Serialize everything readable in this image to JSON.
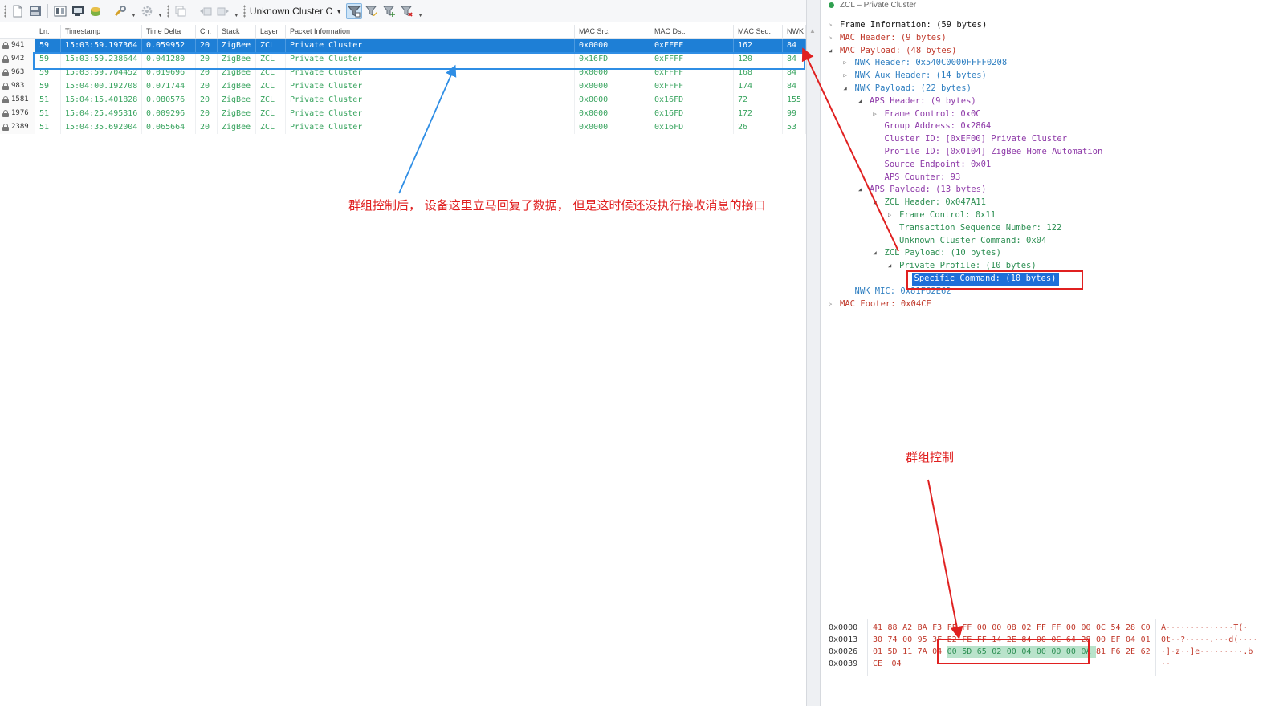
{
  "toolbar": {
    "filter_label": "Unknown Cluster C"
  },
  "packet_list": {
    "columns": [
      {
        "key": "num",
        "label": ""
      },
      {
        "key": "ln",
        "label": "Ln."
      },
      {
        "key": "ts",
        "label": "Timestamp"
      },
      {
        "key": "delta",
        "label": "Time Delta"
      },
      {
        "key": "ch",
        "label": "Ch."
      },
      {
        "key": "stack",
        "label": "Stack"
      },
      {
        "key": "layer",
        "label": "Layer"
      },
      {
        "key": "info",
        "label": "Packet Information"
      },
      {
        "key": "src",
        "label": "MAC Src."
      },
      {
        "key": "dst",
        "label": "MAC Dst."
      },
      {
        "key": "seq",
        "label": "MAC Seq."
      },
      {
        "key": "nwk",
        "label": "NWK"
      }
    ],
    "rows": [
      {
        "num": "941",
        "ln": "59",
        "ts": "15:03:59.197364",
        "delta": "0.059952",
        "ch": "20",
        "stack": "ZigBee",
        "layer": "ZCL",
        "info": "Private Cluster",
        "src": "0x0000",
        "dst": "0xFFFF",
        "seq": "162",
        "nwk": "84",
        "selected": true
      },
      {
        "num": "942",
        "ln": "59",
        "ts": "15:03:59.238644",
        "delta": "0.041280",
        "ch": "20",
        "stack": "ZigBee",
        "layer": "ZCL",
        "info": "Private Cluster",
        "src": "0x16FD",
        "dst": "0xFFFF",
        "seq": "120",
        "nwk": "84",
        "selected": false
      },
      {
        "num": "963",
        "ln": "59",
        "ts": "15:03:59.704452",
        "delta": "0.019696",
        "ch": "20",
        "stack": "ZigBee",
        "layer": "ZCL",
        "info": "Private Cluster",
        "src": "0x0000",
        "dst": "0xFFFF",
        "seq": "168",
        "nwk": "84",
        "selected": false
      },
      {
        "num": "983",
        "ln": "59",
        "ts": "15:04:00.192708",
        "delta": "0.071744",
        "ch": "20",
        "stack": "ZigBee",
        "layer": "ZCL",
        "info": "Private Cluster",
        "src": "0x0000",
        "dst": "0xFFFF",
        "seq": "174",
        "nwk": "84",
        "selected": false
      },
      {
        "num": "1581",
        "ln": "51",
        "ts": "15:04:15.401828",
        "delta": "0.080576",
        "ch": "20",
        "stack": "ZigBee",
        "layer": "ZCL",
        "info": "Private Cluster",
        "src": "0x0000",
        "dst": "0x16FD",
        "seq": "72",
        "nwk": "155",
        "selected": false
      },
      {
        "num": "1976",
        "ln": "51",
        "ts": "15:04:25.495316",
        "delta": "0.009296",
        "ch": "20",
        "stack": "ZigBee",
        "layer": "ZCL",
        "info": "Private Cluster",
        "src": "0x0000",
        "dst": "0x16FD",
        "seq": "172",
        "nwk": "99",
        "selected": false
      },
      {
        "num": "2389",
        "ln": "51",
        "ts": "15:04:35.692004",
        "delta": "0.065664",
        "ch": "20",
        "stack": "ZigBee",
        "layer": "ZCL",
        "info": "Private Cluster",
        "src": "0x0000",
        "dst": "0x16FD",
        "seq": "26",
        "nwk": "53",
        "selected": false
      }
    ]
  },
  "detail": {
    "title": "ZCL – Private Cluster",
    "nodes": [
      {
        "level": 0,
        "exp": "closed",
        "text": "Frame Information: (59 bytes)",
        "color": "#111111"
      },
      {
        "level": 0,
        "exp": "closed",
        "text": "MAC Header: (9 bytes)",
        "color": "#c0392b"
      },
      {
        "level": 0,
        "exp": "open",
        "text": "MAC Payload: (48 bytes)",
        "color": "#c0392b"
      },
      {
        "level": 1,
        "exp": "closed",
        "text": "NWK Header: 0x540C0000FFFF0208",
        "color": "#2f7fc1"
      },
      {
        "level": 1,
        "exp": "closed",
        "text": "NWK Aux Header: (14 bytes)",
        "color": "#2f7fc1"
      },
      {
        "level": 1,
        "exp": "open",
        "text": "NWK Payload: (22 bytes)",
        "color": "#2f7fc1"
      },
      {
        "level": 2,
        "exp": "open",
        "text": "APS Header: (9 bytes)",
        "color": "#8e3aa8"
      },
      {
        "level": 3,
        "exp": "closed",
        "text": "Frame Control: 0x0C",
        "color": "#8e3aa8"
      },
      {
        "level": 3,
        "exp": "none",
        "text": "Group Address: 0x2864",
        "color": "#8e3aa8"
      },
      {
        "level": 3,
        "exp": "none",
        "text": "Cluster ID: [0xEF00] Private Cluster",
        "color": "#8e3aa8"
      },
      {
        "level": 3,
        "exp": "none",
        "text": "Profile ID: [0x0104] ZigBee Home Automation",
        "color": "#8e3aa8"
      },
      {
        "level": 3,
        "exp": "none",
        "text": "Source Endpoint: 0x01",
        "color": "#8e3aa8"
      },
      {
        "level": 3,
        "exp": "none",
        "text": "APS Counter: 93",
        "color": "#8e3aa8"
      },
      {
        "level": 2,
        "exp": "open",
        "text": "APS Payload: (13 bytes)",
        "color": "#8e3aa8"
      },
      {
        "level": 3,
        "exp": "open",
        "text": "ZCL Header: 0x047A11",
        "color": "#2d8f53"
      },
      {
        "level": 4,
        "exp": "closed",
        "text": "Frame Control: 0x11",
        "color": "#2d8f53"
      },
      {
        "level": 4,
        "exp": "none",
        "text": "Transaction Sequence Number: 122",
        "color": "#2d8f53"
      },
      {
        "level": 4,
        "exp": "none",
        "text": "Unknown Cluster Command: 0x04",
        "color": "#2d8f53"
      },
      {
        "level": 3,
        "exp": "open",
        "text": "ZCL Payload: (10 bytes)",
        "color": "#2d8f53"
      },
      {
        "level": 4,
        "exp": "open",
        "text": "Private Profile: (10 bytes)",
        "color": "#2d8f53"
      },
      {
        "level": 5,
        "exp": "none",
        "text": "Specific Command: (10 bytes)",
        "color": "#ffffff",
        "selected": true
      },
      {
        "level": 1,
        "exp": "none",
        "text": "NWK MIC: 0x81F62E62",
        "color": "#2f7fc1"
      },
      {
        "level": 0,
        "exp": "closed",
        "text": "MAC Footer: 0x04CE",
        "color": "#c0392b"
      }
    ]
  },
  "hex": {
    "offsets": [
      "0x0000",
      "0x0013",
      "0x0026",
      "0x0039"
    ],
    "lines": [
      [
        "41",
        "88",
        "A2",
        "BA",
        "F3",
        "FF",
        "FF",
        "00",
        "00",
        "08",
        "02",
        "FF",
        "FF",
        "00",
        "00",
        "0C",
        "54",
        "28",
        "C0"
      ],
      [
        "30",
        "74",
        "00",
        "95",
        "3F",
        "E2",
        "FE",
        "FF",
        "14",
        "2E",
        "84",
        "00",
        "0C",
        "64",
        "28",
        "00",
        "EF",
        "04",
        "01"
      ],
      [
        "01",
        "5D",
        "11",
        "7A",
        "04",
        "00",
        "5D",
        "65",
        "02",
        "00",
        "04",
        "00",
        "00",
        "00",
        "0A",
        "81",
        "F6",
        "2E",
        "62"
      ],
      [
        "CE",
        "04"
      ]
    ],
    "highlight": {
      "line": 2,
      "start": 5,
      "end": 14
    },
    "ascii": [
      "A··············T(·",
      "0t··?·····.···d(····",
      "·]·z··]e·········.b",
      "··"
    ]
  },
  "annotations": {
    "blue_note": "群组控制后， 设备这里立马回复了数据， 但是这时候还没执行接收消息的接口",
    "red_note": "群组控制"
  },
  "colors": {
    "selection_blue": "#1e7fd6",
    "zcl_green": "#39a45f",
    "annotation_red": "#e02020",
    "annotation_blue": "#2f8ee5"
  }
}
